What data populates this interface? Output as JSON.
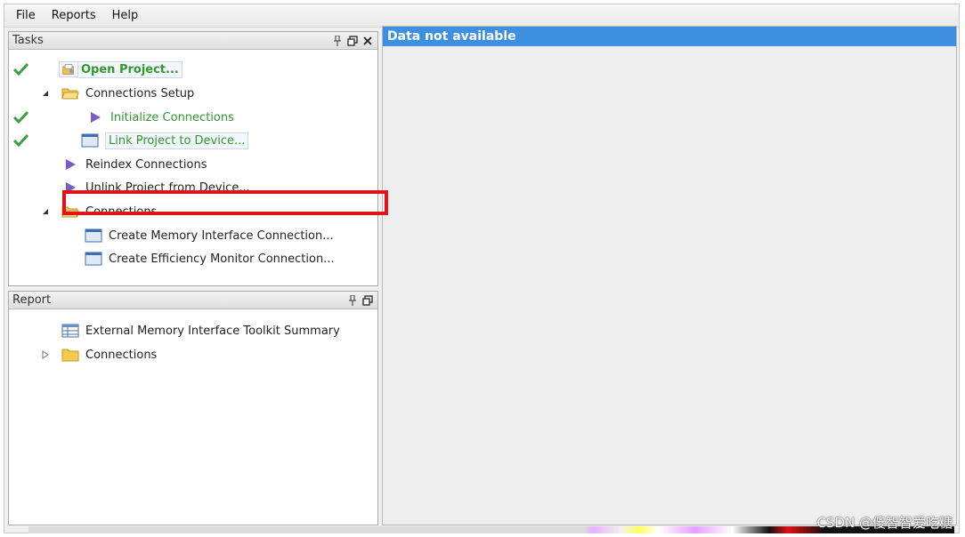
{
  "menu": [
    "File",
    "Reports",
    "Help"
  ],
  "tasks_panel": {
    "title": "Tasks",
    "items": [
      {
        "label": "Open Project...",
        "done": true
      },
      {
        "label": "Connections Setup"
      },
      {
        "label": "Initialize Connections",
        "done": true
      },
      {
        "label": "Link Project to Device...",
        "done": true
      },
      {
        "label": "Reindex Connections"
      },
      {
        "label": "Unlink Project from Device..."
      },
      {
        "label": "Connections"
      },
      {
        "label": "Create Memory Interface Connection...",
        "highlighted": true
      },
      {
        "label": "Create Efficiency Monitor Connection..."
      }
    ]
  },
  "report_panel": {
    "title": "Report",
    "items": [
      {
        "label": "External Memory Interface Toolkit Summary"
      },
      {
        "label": "Connections"
      }
    ]
  },
  "main": {
    "header": "Data not available"
  },
  "watermark": "CSDN @傻智智爱吃糖",
  "colors": {
    "accent": "#3d8fe0",
    "done": "#2e9a2e",
    "highlight": "#e0121b"
  }
}
